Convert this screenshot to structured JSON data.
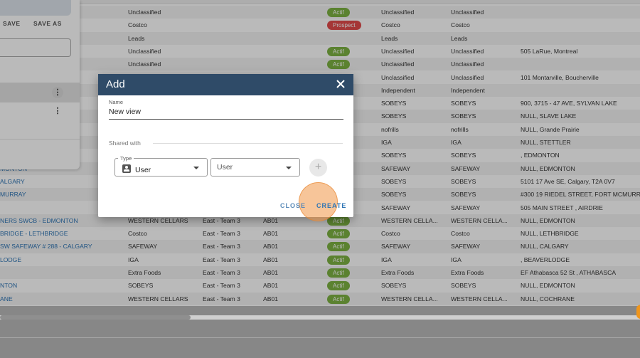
{
  "left_panel": {
    "save_label": "SAVE",
    "save_as_label": "SAVE AS"
  },
  "rows": [
    {
      "name": "",
      "chain": "Unclassified",
      "region": "",
      "code": "",
      "status": "Actif",
      "banner": "Unclassified",
      "banner2": "Unclassified",
      "address": ""
    },
    {
      "name": "",
      "chain": "Costco",
      "region": "",
      "code": "",
      "status": "Prospect",
      "banner": "Costco",
      "banner2": "Costco",
      "address": ""
    },
    {
      "name": "",
      "chain": "Leads",
      "region": "",
      "code": "",
      "status": "",
      "banner": "Leads",
      "banner2": "Leads",
      "address": ""
    },
    {
      "name": "",
      "chain": "Unclassified",
      "region": "",
      "code": "",
      "status": "Actif",
      "banner": "Unclassified",
      "banner2": "Unclassified",
      "address": "505 LaRue, Montreal"
    },
    {
      "name": "",
      "chain": "Unclassified",
      "region": "",
      "code": "",
      "status": "Actif",
      "banner": "Unclassified",
      "banner2": "Unclassified",
      "address": ""
    },
    {
      "name": "",
      "chain": "",
      "region": "",
      "code": "",
      "status": "",
      "banner": "Unclassified",
      "banner2": "Unclassified",
      "address": "101 Montarville, Boucherville"
    },
    {
      "name": "",
      "chain": "",
      "region": "",
      "code": "",
      "status": "",
      "banner": "Independent",
      "banner2": "Independent",
      "address": ""
    },
    {
      "name": "",
      "chain": "",
      "region": "",
      "code": "",
      "status": "",
      "banner": "SOBEYS",
      "banner2": "SOBEYS",
      "address": "900, 3715 - 47 AVE, SYLVAN LAKE"
    },
    {
      "name": "",
      "chain": "",
      "region": "",
      "code": "",
      "status": "",
      "banner": "SOBEYS",
      "banner2": "SOBEYS",
      "address": "NULL, SLAVE LAKE"
    },
    {
      "name": "",
      "chain": "",
      "region": "",
      "code": "",
      "status": "",
      "banner": "nofrills",
      "banner2": "nofrills",
      "address": "NULL, Grande Prairie"
    },
    {
      "name": "",
      "chain": "",
      "region": "",
      "code": "",
      "status": "",
      "banner": "IGA",
      "banner2": "IGA",
      "address": "NULL, STETTLER"
    },
    {
      "name": "",
      "chain": "",
      "region": "",
      "code": "",
      "status": "",
      "banner": "SOBEYS",
      "banner2": "SOBEYS",
      "address": ", EDMONTON"
    },
    {
      "name": "MONTON",
      "chain": "",
      "region": "",
      "code": "",
      "status": "",
      "banner": "SAFEWAY",
      "banner2": "SAFEWAY",
      "address": "NULL, EDMONTON"
    },
    {
      "name": "ALGARY",
      "chain": "",
      "region": "",
      "code": "",
      "status": "",
      "banner": "SOBEYS",
      "banner2": "SOBEYS",
      "address": "5101 17 Ave SE, Calgary, T2A 0V7"
    },
    {
      "name": "MURRAY",
      "chain": "",
      "region": "",
      "code": "",
      "status": "",
      "banner": "SOBEYS",
      "banner2": "SOBEYS",
      "address": "#300 19 RIEDEL STREET, FORT MCMURRAY"
    },
    {
      "name": "",
      "chain": "",
      "region": "",
      "code": "",
      "status": "",
      "banner": "SAFEWAY",
      "banner2": "SAFEWAY",
      "address": "505 MAIN STREET , AIRDRIE"
    },
    {
      "name": "NERS SWCB - EDMONTON",
      "chain": "WESTERN CELLARS",
      "region": "East - Team 3",
      "code": "AB01",
      "status": "Actif",
      "banner": "WESTERN CELLA...",
      "banner2": "WESTERN CELLA...",
      "address": "NULL, EDMONTON"
    },
    {
      "name": "BRIDGE - LETHBRIDGE",
      "chain": "Costco",
      "region": "East - Team 3",
      "code": "AB01",
      "status": "Actif",
      "banner": "Costco",
      "banner2": "Costco",
      "address": "NULL, LETHBRIDGE"
    },
    {
      "name": "SW SAFEWAY # 288 - CALGARY",
      "chain": "SAFEWAY",
      "region": "East - Team 3",
      "code": "AB01",
      "status": "Actif",
      "banner": "SAFEWAY",
      "banner2": "SAFEWAY",
      "address": "NULL, CALGARY"
    },
    {
      "name": "LODGE",
      "chain": "IGA",
      "region": "East - Team 3",
      "code": "AB01",
      "status": "Actif",
      "banner": "IGA",
      "banner2": "IGA",
      "address": ", BEAVERLODGE"
    },
    {
      "name": "",
      "chain": "Extra Foods",
      "region": "East - Team 3",
      "code": "AB01",
      "status": "Actif",
      "banner": "Extra Foods",
      "banner2": "Extra Foods",
      "address": "EF Athabasca 52 St , ATHABASCA"
    },
    {
      "name": "NTON",
      "chain": "SOBEYS",
      "region": "East - Team 3",
      "code": "AB01",
      "status": "Actif",
      "banner": "SOBEYS",
      "banner2": "SOBEYS",
      "address": "NULL, EDMONTON"
    },
    {
      "name": "ANE",
      "chain": "WESTERN CELLARS",
      "region": "East - Team 3",
      "code": "AB01",
      "status": "Actif",
      "banner": "WESTERN CELLA...",
      "banner2": "WESTERN CELLA...",
      "address": "NULL, COCHRANE"
    }
  ],
  "dialog": {
    "title": "Add",
    "name_label": "Name",
    "name_value": "New view",
    "shared_with_label": "Shared with",
    "type_label": "Type",
    "type_value": "User",
    "user_value": "User",
    "add_symbol": "+",
    "close_label": "CLOSE",
    "create_label": "CREATE"
  },
  "colors": {
    "header": "#2f4b68",
    "badge_actif": "#7db243",
    "badge_prospect": "#e24a4a",
    "link": "#2d74b4",
    "ripple": "#f0a050"
  }
}
